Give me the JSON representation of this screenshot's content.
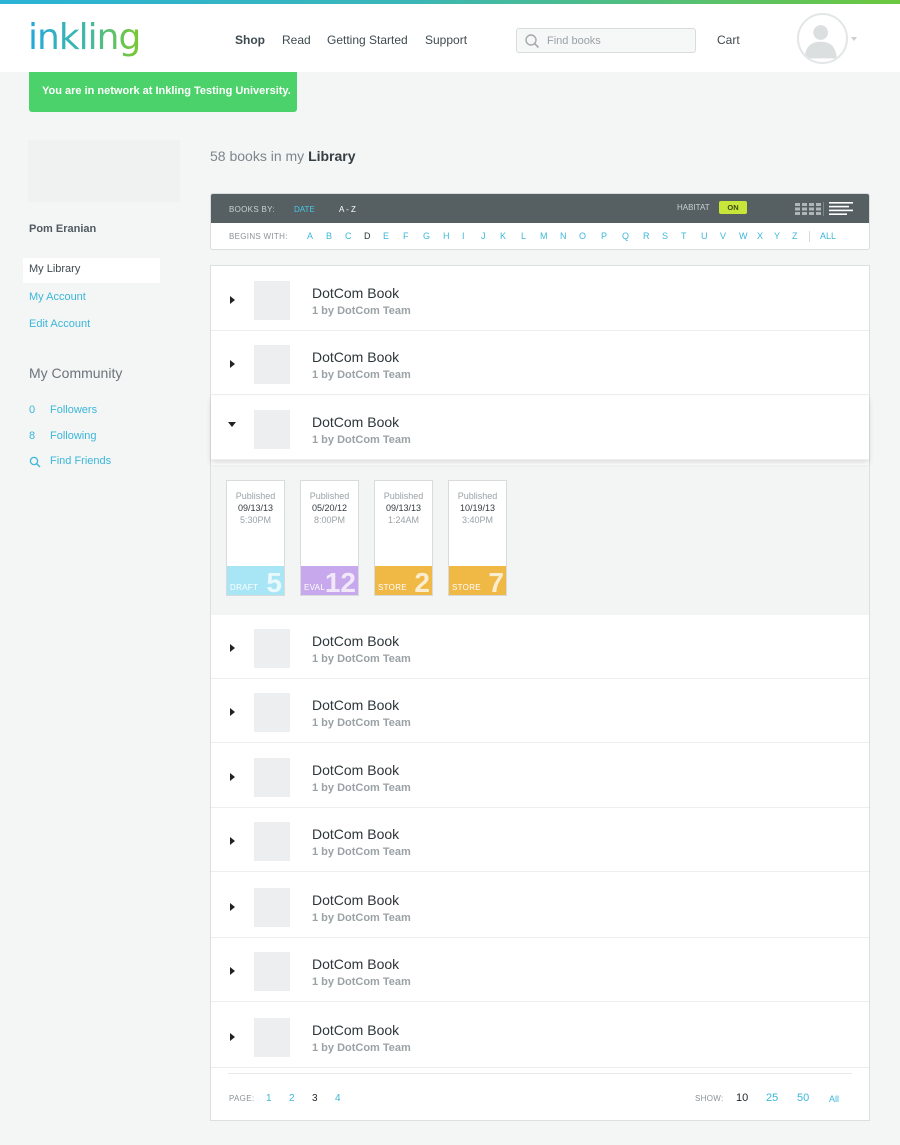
{
  "header": {
    "logo": "inkling",
    "nav": [
      "Shop",
      "Read",
      "Getting Started",
      "Support"
    ],
    "search_placeholder": "Find books",
    "cart": "Cart"
  },
  "banner": "You are in network at Inkling Testing University.",
  "sidebar": {
    "username": "Pom Eranian",
    "links": [
      "My Library",
      "My Account",
      "Edit Account"
    ],
    "community_heading": "My Community",
    "followers": {
      "count": "0",
      "label": "Followers"
    },
    "following": {
      "count": "8",
      "label": "Following"
    },
    "find_friends": "Find Friends"
  },
  "library": {
    "count_text": "58 books in my",
    "title": "Library"
  },
  "filter": {
    "books_by_label": "BOOKS BY:",
    "sort_date": "DATE",
    "sort_az": "A - Z",
    "habitat_label": "HABITAT",
    "habitat_toggle": "ON",
    "begins_with_label": "BEGINS WITH:",
    "letters": [
      "A",
      "B",
      "C",
      "D",
      "E",
      "F",
      "G",
      "H",
      "I",
      "J",
      "K",
      "L",
      "M",
      "N",
      "O",
      "P",
      "Q",
      "R",
      "S",
      "T",
      "U",
      "V",
      "W",
      "X",
      "Y",
      "Z"
    ],
    "current_letter": "D",
    "all_label": "ALL"
  },
  "books": [
    {
      "title": "DotCom Book",
      "byline": "1 by DotCom Team"
    },
    {
      "title": "DotCom Book",
      "byline": "1 by DotCom Team"
    },
    {
      "title": "DotCom Book",
      "byline": "1 by DotCom Team"
    },
    {
      "title": "DotCom Book",
      "byline": "1 by DotCom Team"
    },
    {
      "title": "DotCom Book",
      "byline": "1 by DotCom Team"
    },
    {
      "title": "DotCom Book",
      "byline": "1 by DotCom Team"
    },
    {
      "title": "DotCom Book",
      "byline": "1 by DotCom Team"
    },
    {
      "title": "DotCom Book",
      "byline": "1 by DotCom Team"
    },
    {
      "title": "DotCom Book",
      "byline": "1 by DotCom Team"
    },
    {
      "title": "DotCom Book",
      "byline": "1 by DotCom Team"
    }
  ],
  "versions": [
    {
      "label": "Published",
      "date": "09/13/13",
      "time": "5:30PM",
      "stage": "DRAFT",
      "number": "5",
      "color": "#a8e6f6"
    },
    {
      "label": "Published",
      "date": "05/20/12",
      "time": "8:00PM",
      "stage": "EVAL",
      "number": "12",
      "color": "#c7a8ec"
    },
    {
      "label": "Published",
      "date": "09/13/13",
      "time": "1:24AM",
      "stage": "STORE",
      "number": "2",
      "color": "#f0b845"
    },
    {
      "label": "Published",
      "date": "10/19/13",
      "time": "3:40PM",
      "stage": "STORE",
      "number": "7",
      "color": "#f0b845"
    }
  ],
  "pager": {
    "page_label": "PAGE:",
    "pages": [
      "1",
      "2",
      "3",
      "4"
    ],
    "current_page": "3",
    "show_label": "SHOW:",
    "show_options": [
      "10",
      "25",
      "50",
      "All"
    ],
    "current_show": "10"
  },
  "colors": {
    "accent": "#3bb7d9",
    "banner": "#4cd26b",
    "filter_bar": "#566063",
    "habitat_on": "#c8e63a"
  }
}
